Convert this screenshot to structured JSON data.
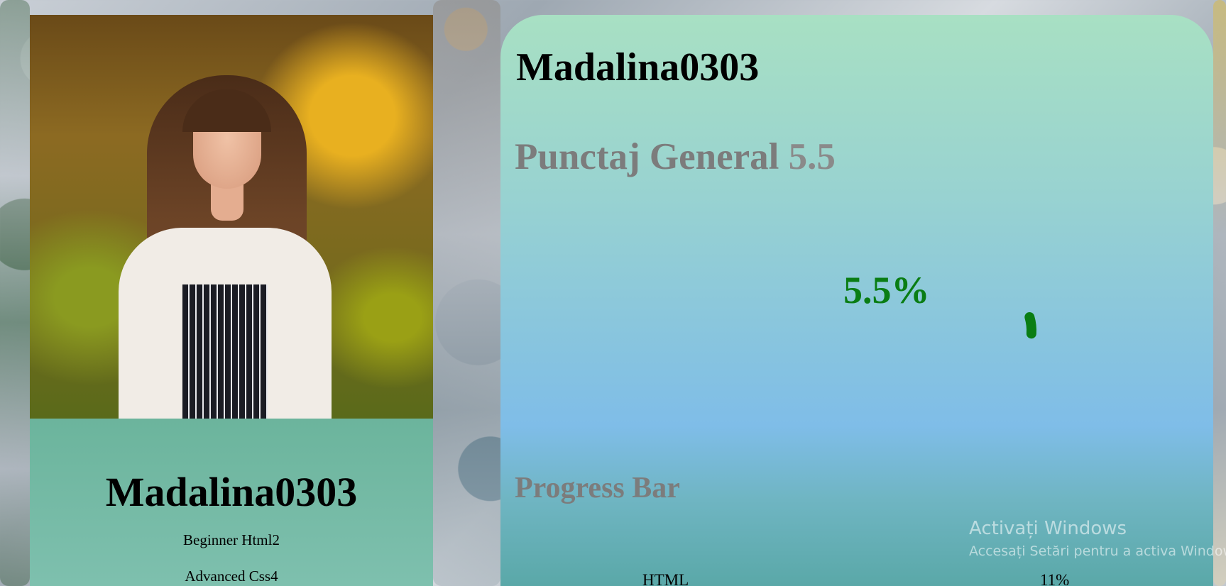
{
  "profile_card": {
    "photo_alt": "profile photo",
    "name": "Madalina0303",
    "skills": [
      "Beginner Html2",
      "Advanced Css4"
    ]
  },
  "stats_panel": {
    "name": "Madalina0303",
    "general_score_label": "Punctaj General",
    "general_score_value": "5.5",
    "progress_percent_label": "5.5%",
    "progress_percent": 5.5,
    "progress_color": "#0a7d14",
    "progress_bar_title": "Progress Bar",
    "skill_progress": [
      {
        "label": "HTML",
        "value": "11%"
      }
    ]
  },
  "watermark": {
    "title": "Activați Windows",
    "subtitle": "Accesați Setări pentru a activa Windows."
  }
}
